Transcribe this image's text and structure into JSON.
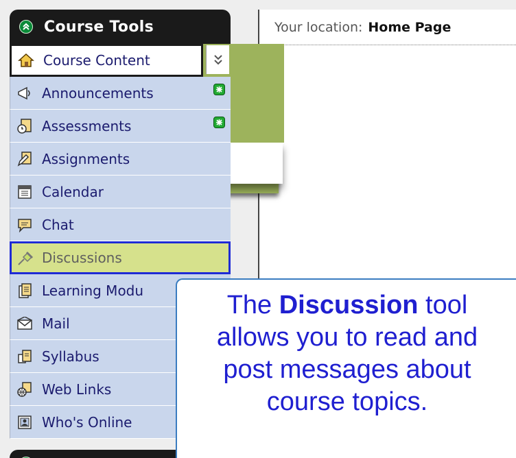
{
  "sidebar": {
    "title": "Course Tools",
    "current": {
      "label": "Course Content",
      "icon": "home-icon"
    },
    "items": [
      {
        "label": "Announcements",
        "icon": "megaphone-icon",
        "new": true
      },
      {
        "label": "Assessments",
        "icon": "clock-document-icon",
        "new": true
      },
      {
        "label": "Assignments",
        "icon": "pencil-document-icon",
        "new": false
      },
      {
        "label": "Calendar",
        "icon": "calendar-icon",
        "new": false
      },
      {
        "label": "Chat",
        "icon": "speech-bubble-icon",
        "new": false
      },
      {
        "label": "Discussions",
        "icon": "pushpin-icon",
        "new": false,
        "highlighted": true
      },
      {
        "label": "Learning Modu",
        "icon": "document-icon",
        "new": false
      },
      {
        "label": "Mail",
        "icon": "envelope-icon",
        "new": false
      },
      {
        "label": "Syllabus",
        "icon": "book-icon",
        "new": false
      },
      {
        "label": "Web Links",
        "icon": "globe-icon",
        "new": false
      },
      {
        "label": "Who's Online",
        "icon": "person-card-icon",
        "new": false
      }
    ]
  },
  "main": {
    "location_label": "Your location:",
    "location_value": "Home Page"
  },
  "callout": {
    "pre": "The",
    "bold": "Discussion",
    "post": "tool",
    "line2": "allows you to read and",
    "line3": "post messages about",
    "line4": "course topics."
  },
  "colors": {
    "sidebar_item": "#c9d6ec",
    "highlight_fill": "#d6e18c",
    "highlight_border": "#1e2bd6",
    "banner_green": "#9db35c",
    "callout_text": "#1f1fd0"
  }
}
